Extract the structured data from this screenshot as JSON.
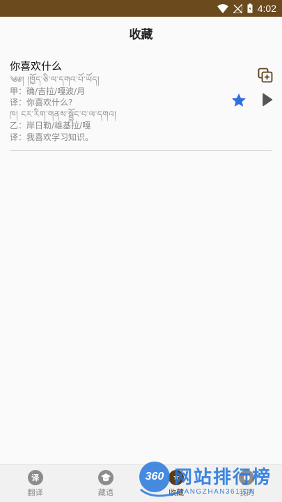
{
  "status_bar": {
    "time": "4:02",
    "icons": [
      "wifi-icon",
      "no-signal-icon",
      "battery-icon"
    ]
  },
  "header": {
    "title": "收藏"
  },
  "favorites": [
    {
      "headline": "你喜欢什么",
      "lines": [
        "༄༅། །ཁྱོད་ཅི་ལ་དགའ་པོ་ཡོད།",
        "甲：确/吉拉/嘎波/月",
        "译：你喜欢什么?",
        "ཁ། ངར་རིག་གནས་སྦྱོང་བ་ལ་དགའ།",
        "乙：岸日勒/雄基拉/嘎",
        "译：我喜欢学习知识。"
      ],
      "actions": [
        "copy-icon",
        "star-icon",
        "play-icon"
      ],
      "starred": true
    }
  ],
  "bottom_nav": {
    "items": [
      {
        "label": "翻译",
        "icon_text": "译",
        "icon": "translate-icon",
        "active": false
      },
      {
        "label": "藏语",
        "icon_text": "▬",
        "icon": "graduation-cap-icon",
        "active": false
      },
      {
        "label": "收藏",
        "icon_text": "★",
        "icon": "star-icon",
        "active": true
      },
      {
        "label": "我的",
        "icon_text": "●",
        "icon": "user-icon",
        "active": false
      }
    ]
  },
  "watermark": {
    "badge": "360",
    "text": "网站排行榜",
    "subtext": "WANGZHAN361.CN"
  },
  "colors": {
    "status_bar": "#6b4a1e",
    "accent": "#5a3d18",
    "star": "#2f6fe0"
  }
}
